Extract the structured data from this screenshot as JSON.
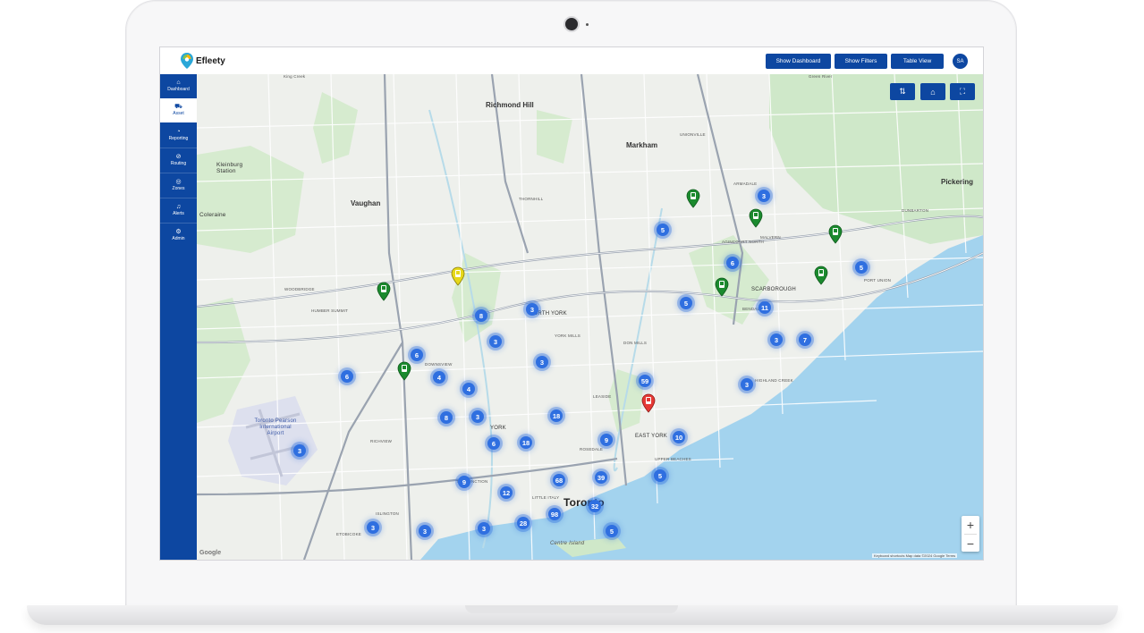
{
  "app": {
    "brand": "Efleety",
    "buttons": {
      "dashboard": "Show Dashboard",
      "filters": "Show Filters",
      "table": "Table View"
    },
    "avatar_initials": "SA",
    "accent": "#0d47a1"
  },
  "sidebar": {
    "items": [
      {
        "label": "Dashboard",
        "icon": "home-icon",
        "active": false
      },
      {
        "label": "Asset",
        "icon": "truck-icon",
        "active": true
      },
      {
        "label": "Reporting",
        "icon": "pie-chart-icon",
        "active": false
      },
      {
        "label": "Routing",
        "icon": "compass-icon",
        "active": false
      },
      {
        "label": "Zones",
        "icon": "zones-icon",
        "active": false
      },
      {
        "label": "Alerts",
        "icon": "bell-icon",
        "active": false
      },
      {
        "label": "Admin",
        "icon": "gear-icon",
        "active": false
      }
    ]
  },
  "map": {
    "controls": [
      "swap-icon",
      "home-icon",
      "fullscreen-icon"
    ],
    "zoom_in": "+",
    "zoom_out": "−",
    "google": "Google",
    "attribution": "Keyboard shortcuts   Map data ©2024 Google   Terms",
    "clusters": [
      "3",
      "5",
      "6",
      "6",
      "3",
      "11",
      "5",
      "7",
      "3",
      "5",
      "3",
      "3",
      "8",
      "3",
      "6",
      "4",
      "4",
      "3",
      "8",
      "59",
      "18",
      "6",
      "18",
      "9",
      "10",
      "3",
      "68",
      "39",
      "5",
      "9",
      "12",
      "32",
      "98",
      "28",
      "3",
      "3",
      "5",
      "3"
    ],
    "pins": [
      {
        "status": "green"
      },
      {
        "status": "green"
      },
      {
        "status": "green"
      },
      {
        "status": "green"
      },
      {
        "status": "green"
      },
      {
        "status": "green"
      },
      {
        "status": "yellow"
      },
      {
        "status": "red"
      }
    ],
    "status_colors": {
      "green": "#1b8a2e",
      "yellow": "#e6d81a",
      "red": "#e53935"
    },
    "places": {
      "richmond_hill": "Richmond Hill",
      "markham": "Markham",
      "vaughan": "Vaughan",
      "kleinburg": "Kleinburg Station",
      "coleraine": "Coleraine",
      "pickering": "Pickering",
      "scarborough": "SCARBOROUGH",
      "north_york": "NORTH YORK",
      "york": "YORK",
      "east_york": "EAST YORK",
      "toronto": "Toronto",
      "pearson": "Toronto Pearson International Airport",
      "centre_island": "Centre Island",
      "king_creek": "King Creek",
      "green_river": "Green River",
      "unionville": "UNIONVILLE",
      "malvern": "MALVERN",
      "agincourt": "AGINCOURT NORTH",
      "downsview": "DOWNSVIEW",
      "etobicoke": "ETOBICOKE",
      "leaside": "LEASIDE",
      "rosedale": "ROSEDALE",
      "little_italy": "LITTLE ITALY",
      "thornhill": "THORNHILL",
      "woodbridge": "WOODBRIDGE",
      "richview": "RICHVIEW",
      "armadale": "ARMADALE",
      "dunbarton": "DUNBARTON",
      "port_union": "PORT UNION",
      "bendale": "BENDALE",
      "don_mills": "DON MILLS",
      "york_mills": "YORK MILLS",
      "upper_beaches": "UPPER BEACHES",
      "the_junction": "THE JUNCTION",
      "humber_summit": "HUMBER SUMMIT",
      "highland_creek": "HIGHLAND CREEK",
      "islington": "ISLINGTON"
    }
  }
}
